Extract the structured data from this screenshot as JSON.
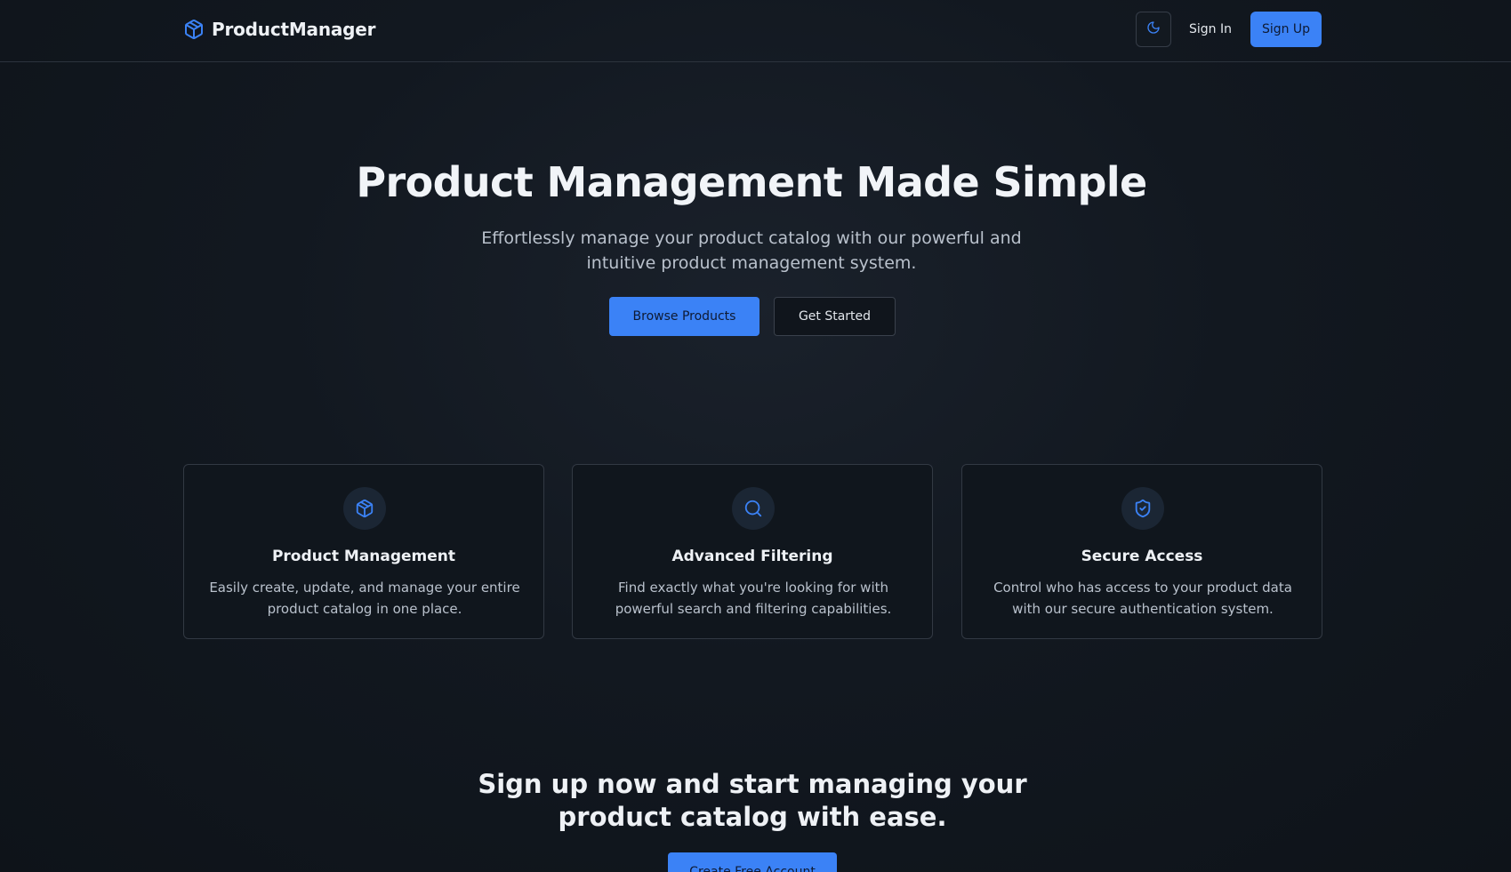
{
  "header": {
    "brand_name": "ProductManager",
    "brand_icon": "package-icon",
    "theme_toggle_icon": "moon-icon",
    "sign_in_label": "Sign In",
    "sign_up_label": "Sign Up"
  },
  "hero": {
    "title": "Product Management Made Simple",
    "subtitle": "Effortlessly manage your product catalog with our powerful and intuitive product management system.",
    "primary_button": "Browse Products",
    "secondary_button": "Get Started"
  },
  "features": [
    {
      "icon": "package-icon",
      "title": "Product Management",
      "description": "Easily create, update, and manage your entire product catalog in one place."
    },
    {
      "icon": "search-icon",
      "title": "Advanced Filtering",
      "description": "Find exactly what you're looking for with powerful search and filtering capabilities."
    },
    {
      "icon": "shield-check-icon",
      "title": "Secure Access",
      "description": "Control who has access to your product data with our secure authentication system."
    }
  ],
  "cta": {
    "title": "Sign up now and start managing your product catalog with ease.",
    "button": "Create Free Account"
  },
  "colors": {
    "accent": "#3b82f6",
    "background": "#0f141b",
    "card_border": "#323943",
    "text_muted": "#b9c1cc"
  }
}
